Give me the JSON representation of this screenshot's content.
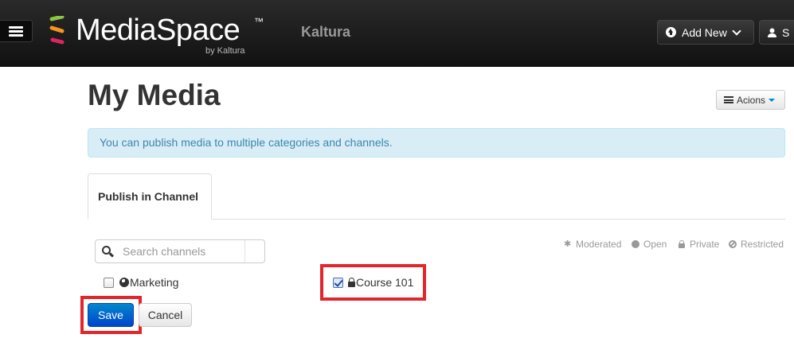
{
  "header": {
    "menu_icon": "hamburger-icon",
    "logo_text": "MediaSpace",
    "logo_tm": "™",
    "logo_sub": "by Kaltura",
    "brand_name": "Kaltura",
    "add_new_label": "Add New",
    "user_label": "S"
  },
  "page": {
    "title": "My Media",
    "actions_label": "Acions"
  },
  "alert": {
    "text": "You can publish media to multiple categories and channels."
  },
  "tabs": [
    {
      "label": "Publish in Channel",
      "active": true
    }
  ],
  "search": {
    "placeholder": "Search channels",
    "value": ""
  },
  "legend": [
    {
      "icon": "asterisk-icon",
      "label": "Moderated"
    },
    {
      "icon": "globe-icon",
      "label": "Open"
    },
    {
      "icon": "lock-icon",
      "label": "Private"
    },
    {
      "icon": "ban-icon",
      "label": "Restricted"
    }
  ],
  "channels": [
    {
      "name": "Marketing",
      "icon": "globe-icon",
      "checked": false
    },
    {
      "name": "Course 101",
      "icon": "lock-icon",
      "checked": true
    }
  ],
  "form": {
    "save_label": "Save",
    "cancel_label": "Cancel"
  },
  "colors": {
    "highlight": "#e3262c",
    "primary": "#0066cc",
    "alert_bg": "#d9edf7",
    "alert_text": "#3a87ad"
  }
}
